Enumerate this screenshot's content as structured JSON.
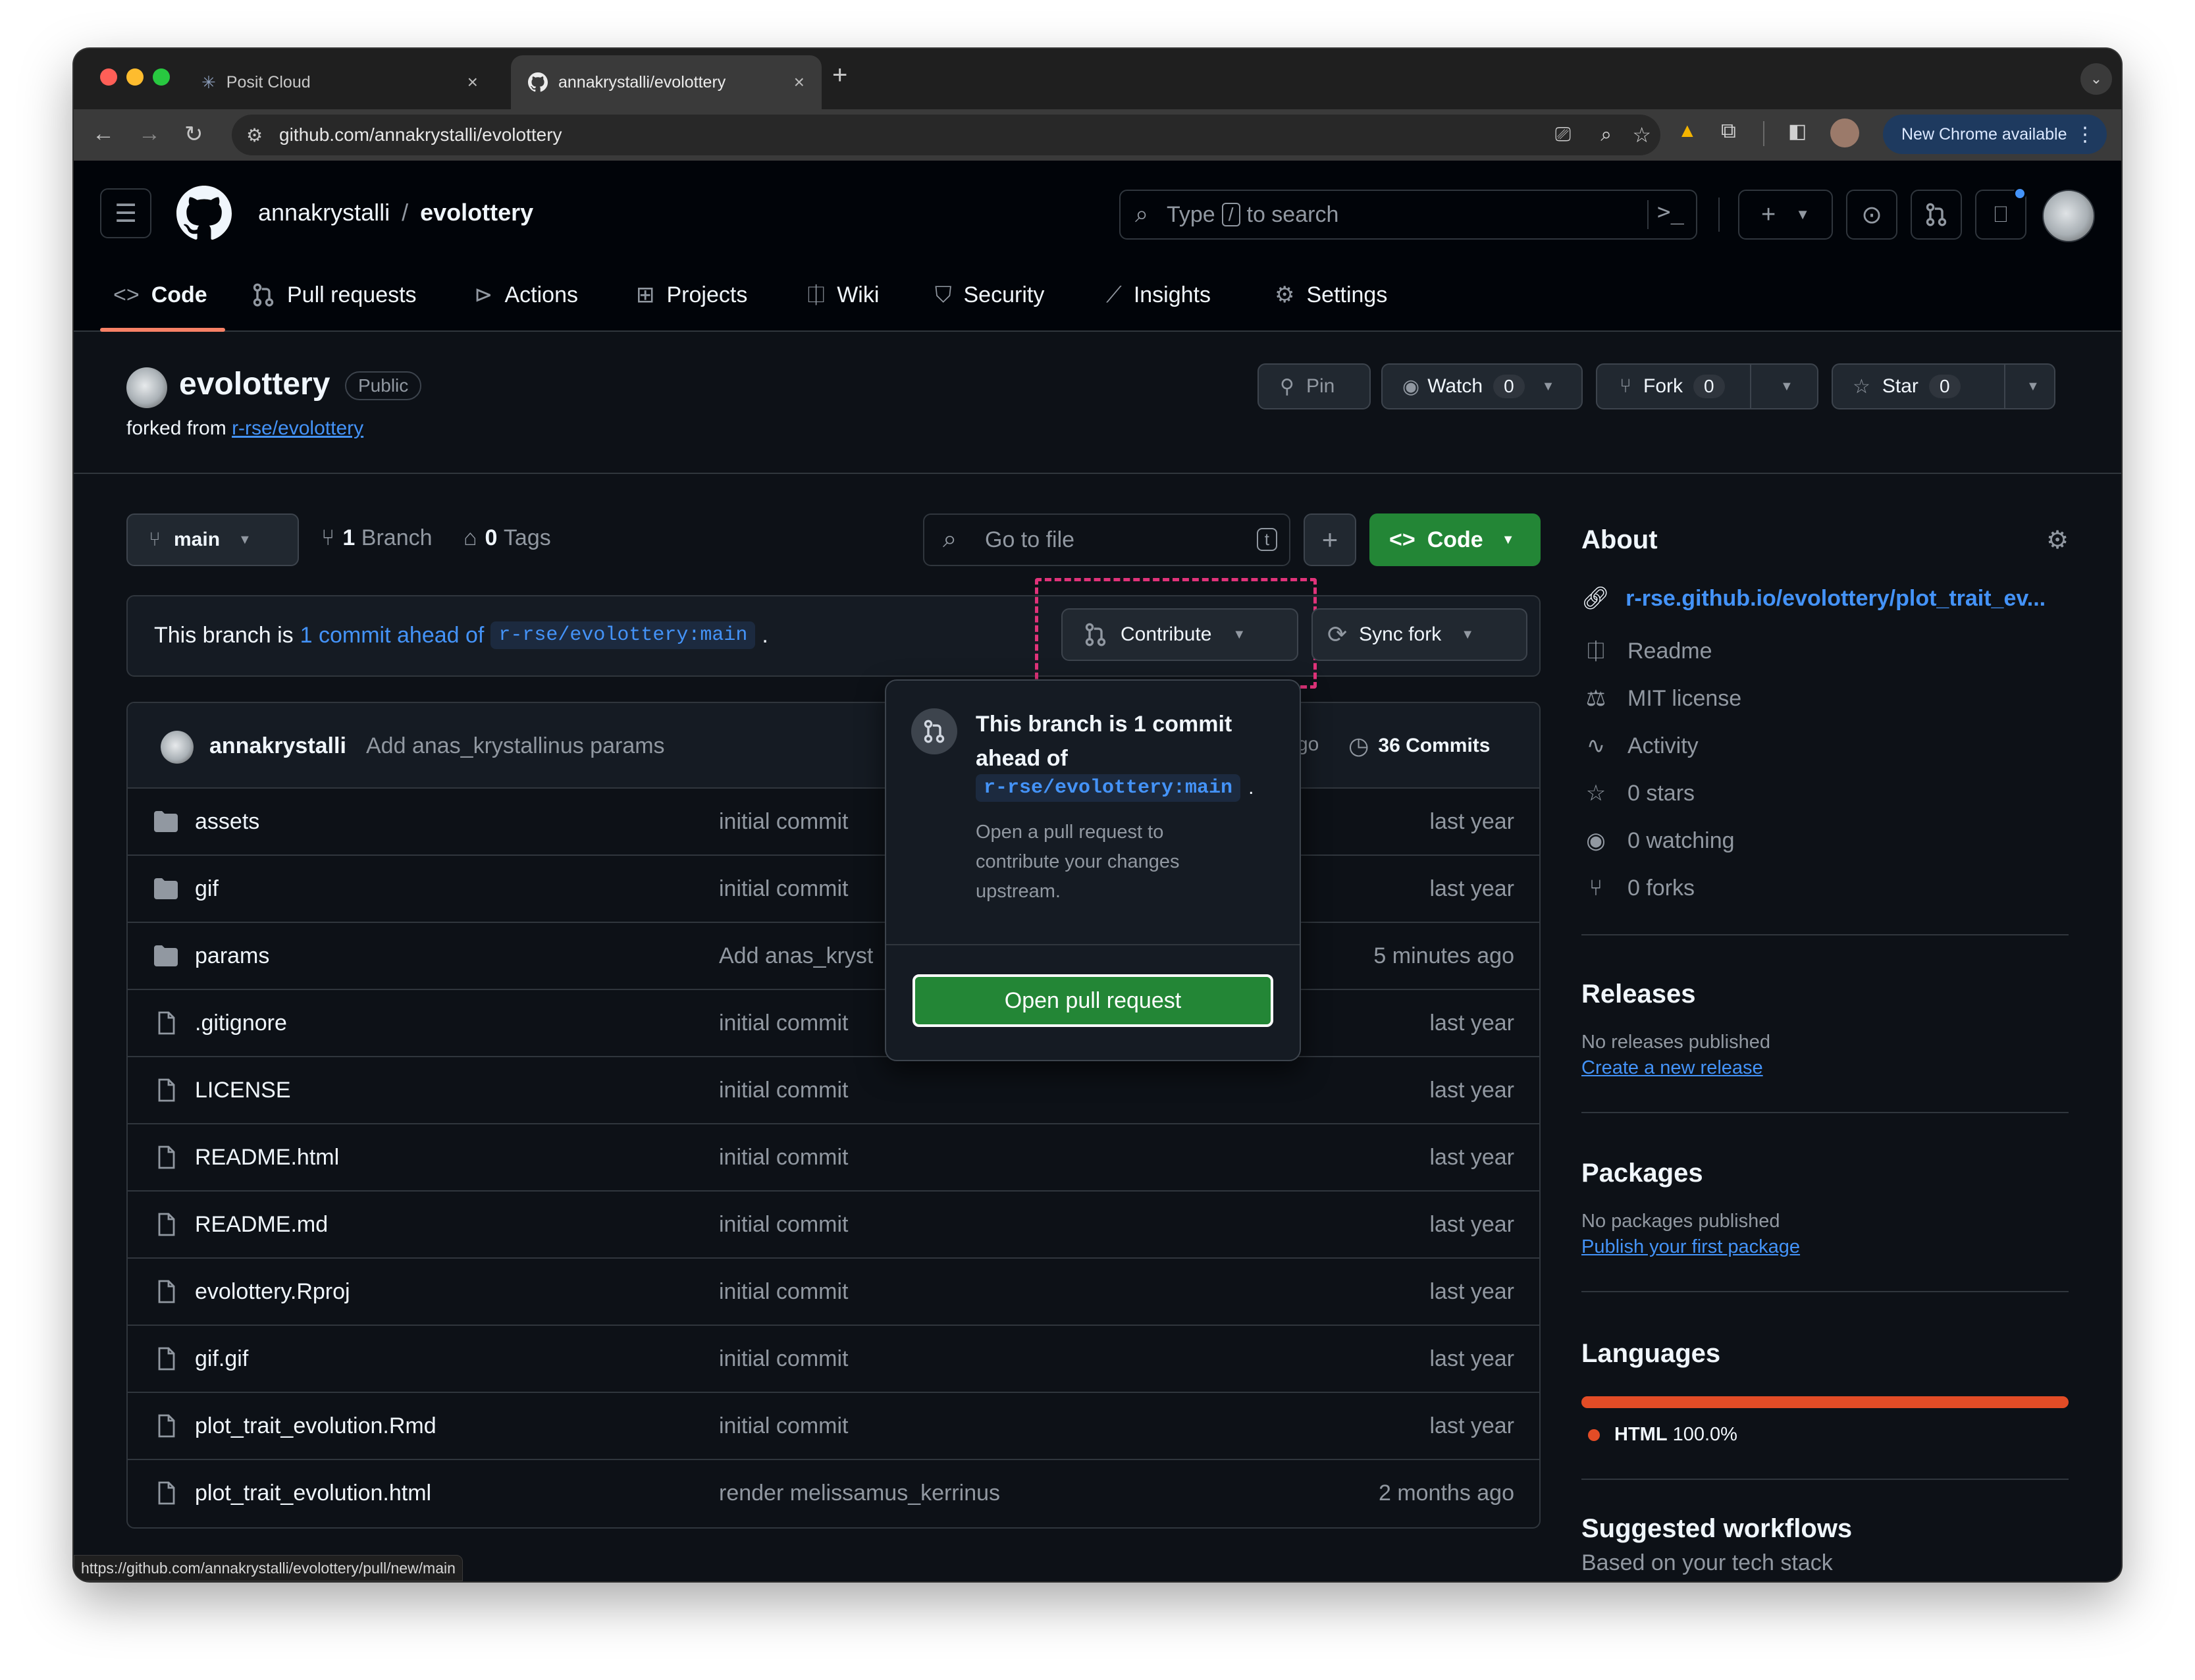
{
  "browser": {
    "tabs": [
      {
        "title": "Posit Cloud",
        "active": false
      },
      {
        "title": "annakrystalli/evolottery",
        "active": true
      }
    ],
    "url": "github.com/annakrystalli/evolottery",
    "update_label": "New Chrome available",
    "status_url": "https://github.com/annakrystalli/evolottery/pull/new/main"
  },
  "header": {
    "owner": "annakrystalli",
    "separator": "/",
    "repo": "evolottery",
    "search_prefix": "Type",
    "search_key": "/",
    "search_suffix": "to search"
  },
  "repo_nav": [
    {
      "label": "Code",
      "icon": "code-icon"
    },
    {
      "label": "Pull requests",
      "icon": "git-pull-request-icon"
    },
    {
      "label": "Actions",
      "icon": "play-icon"
    },
    {
      "label": "Projects",
      "icon": "table-icon"
    },
    {
      "label": "Wiki",
      "icon": "book-icon"
    },
    {
      "label": "Security",
      "icon": "shield-icon"
    },
    {
      "label": "Insights",
      "icon": "graph-icon"
    },
    {
      "label": "Settings",
      "icon": "gear-icon"
    }
  ],
  "repo": {
    "name": "evolottery",
    "visibility": "Public",
    "forked_from_label": "forked from",
    "forked_from": "r-rse/evolottery",
    "pin_label": "Pin",
    "watch_label": "Watch",
    "watch_count": "0",
    "fork_label": "Fork",
    "fork_count": "0",
    "star_label": "Star",
    "star_count": "0"
  },
  "toolbar": {
    "branch": "main",
    "branches_count": "1",
    "branches_label": "Branch",
    "tags_count": "0",
    "tags_label": "Tags",
    "goto_placeholder": "Go to file",
    "goto_key": "t",
    "code_label": "Code"
  },
  "branch_bar": {
    "text_prefix": "This branch is",
    "ahead_link": "1 commit ahead of",
    "ref": "r-rse/evolottery:main",
    "suffix": ".",
    "contribute_label": "Contribute",
    "sync_label": "Sync fork"
  },
  "popover": {
    "title": "This branch is 1 commit ahead of",
    "ref": "r-rse/evolottery:main",
    "ref_suffix": ".",
    "description": "Open a pull request to contribute your changes upstream.",
    "button_label": "Open pull request"
  },
  "latest_commit": {
    "author": "annakrystalli",
    "message": "Add anas_krystallinus params",
    "time_fragment": "go",
    "commits_label": "36 Commits"
  },
  "files": [
    {
      "name": "assets",
      "type": "dir",
      "message": "initial commit",
      "date": "last year"
    },
    {
      "name": "gif",
      "type": "dir",
      "message": "initial commit",
      "date": "last year"
    },
    {
      "name": "params",
      "type": "dir",
      "message": "Add anas_kryst",
      "date": "5 minutes ago"
    },
    {
      "name": ".gitignore",
      "type": "file",
      "message": "initial commit",
      "date": "last year"
    },
    {
      "name": "LICENSE",
      "type": "file",
      "message": "initial commit",
      "date": "last year"
    },
    {
      "name": "README.html",
      "type": "file",
      "message": "initial commit",
      "date": "last year"
    },
    {
      "name": "README.md",
      "type": "file",
      "message": "initial commit",
      "date": "last year"
    },
    {
      "name": "evolottery.Rproj",
      "type": "file",
      "message": "initial commit",
      "date": "last year"
    },
    {
      "name": "gif.gif",
      "type": "file",
      "message": "initial commit",
      "date": "last year"
    },
    {
      "name": "plot_trait_evolution.Rmd",
      "type": "file",
      "message": "initial commit",
      "date": "last year"
    },
    {
      "name": "plot_trait_evolution.html",
      "type": "file",
      "message": "render melissamus_kerrinus",
      "date": "2 months ago"
    }
  ],
  "about": {
    "title": "About",
    "website": "r-rse.github.io/evolottery/plot_trait_ev...",
    "items": [
      {
        "icon": "book-icon",
        "label": "Readme"
      },
      {
        "icon": "law-icon",
        "label": "MIT license"
      },
      {
        "icon": "pulse-icon",
        "label": "Activity"
      },
      {
        "icon": "star-icon",
        "label": "0 stars"
      },
      {
        "icon": "eye-icon",
        "label": "0 watching"
      },
      {
        "icon": "fork-icon",
        "label": "0 forks"
      }
    ]
  },
  "releases": {
    "title": "Releases",
    "empty": "No releases published",
    "link": "Create a new release"
  },
  "packages": {
    "title": "Packages",
    "empty": "No packages published",
    "link": "Publish your first package"
  },
  "languages": {
    "title": "Languages",
    "items": [
      {
        "name": "HTML",
        "percent": "100.0%",
        "value": 100,
        "color": "#e34c26"
      }
    ]
  },
  "workflows": {
    "title": "Suggested workflows",
    "subtitle": "Based on your tech stack"
  },
  "colors": {
    "accent_green": "#238636",
    "link": "#4493f8",
    "highlight": "#e0337a",
    "underline": "#f78166"
  }
}
